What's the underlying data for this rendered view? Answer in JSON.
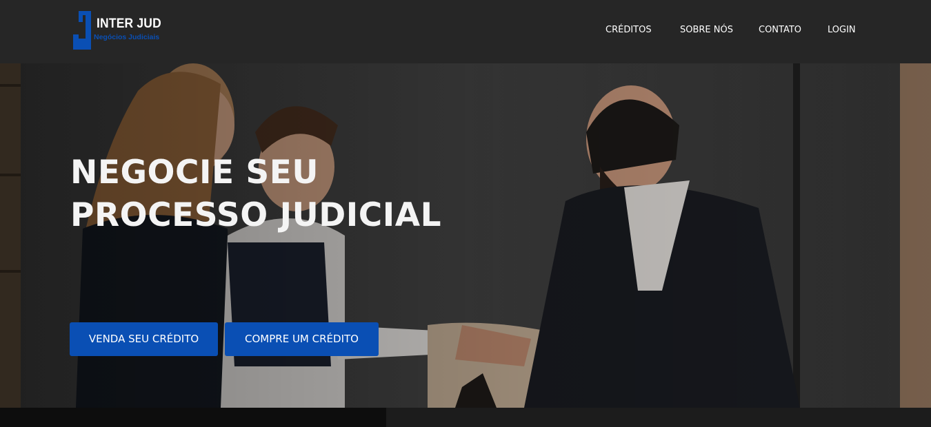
{
  "brand": {
    "name": "INTER JUD",
    "tagline": "Negócios Judiciais",
    "colors": {
      "primary": "#0a4fb4",
      "header_bg": "#262626",
      "text": "#ffffff"
    }
  },
  "nav": {
    "items": [
      {
        "label": "CRÉDITOS"
      },
      {
        "label": "SOBRE NÓS"
      },
      {
        "label": "CONTATO"
      },
      {
        "label": "LOGIN"
      }
    ]
  },
  "hero": {
    "headline_line1": "NEGOCIE SEU",
    "headline_line2": "PROCESSO JUDICIAL",
    "image_icon": "handshake-photo",
    "buttons": {
      "sell": "VENDA SEU CRÉDITO",
      "buy": "COMPRE UM CRÉDITO"
    }
  }
}
